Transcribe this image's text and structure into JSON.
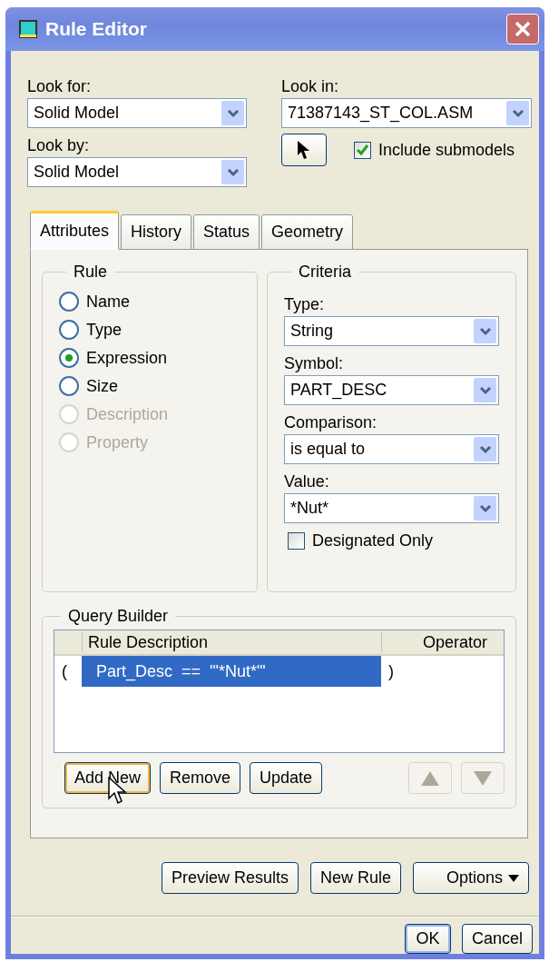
{
  "window": {
    "title": "Rule Editor"
  },
  "look_for": {
    "label": "Look for:",
    "value": "Solid Model"
  },
  "look_by": {
    "label": "Look by:",
    "value": "Solid Model"
  },
  "look_in": {
    "label": "Look in:",
    "value": "71387143_ST_COL.ASM"
  },
  "include_submodels": {
    "label": "Include submodels",
    "checked": true
  },
  "tabs": [
    {
      "label": "Attributes",
      "selected": true
    },
    {
      "label": "History",
      "selected": false
    },
    {
      "label": "Status",
      "selected": false
    },
    {
      "label": "Geometry",
      "selected": false
    }
  ],
  "rule_group": {
    "title": "Rule",
    "options": [
      {
        "label": "Name",
        "selected": false,
        "disabled": false
      },
      {
        "label": "Type",
        "selected": false,
        "disabled": false
      },
      {
        "label": "Expression",
        "selected": true,
        "disabled": false
      },
      {
        "label": "Size",
        "selected": false,
        "disabled": false
      },
      {
        "label": "Description",
        "selected": false,
        "disabled": true
      },
      {
        "label": "Property",
        "selected": false,
        "disabled": true
      }
    ]
  },
  "criteria": {
    "title": "Criteria",
    "fields": [
      {
        "label": "Type:",
        "value": "String"
      },
      {
        "label": "Symbol:",
        "value": "PART_DESC"
      },
      {
        "label": "Comparison:",
        "value": "is equal to"
      },
      {
        "label": "Value:",
        "value": "*Nut*"
      }
    ],
    "designated_only": {
      "label": "Designated Only",
      "checked": false
    }
  },
  "query_builder": {
    "title": "Query Builder",
    "columns": [
      "Rule Description",
      "Operator"
    ],
    "rows": [
      {
        "open": "(",
        "description": "Part_Desc  ==  '\"*Nut*\"'",
        "close": ")",
        "selected": true
      }
    ],
    "buttons": [
      {
        "label": "Add New",
        "focused": true
      },
      {
        "label": "Remove",
        "focused": false
      },
      {
        "label": "Update",
        "focused": false
      }
    ],
    "move_buttons": [
      {
        "kind": "up",
        "disabled": true
      },
      {
        "kind": "down",
        "disabled": true
      }
    ]
  },
  "actions": [
    {
      "label": "Preview Results",
      "kind": "plain"
    },
    {
      "label": "New Rule",
      "kind": "plain"
    },
    {
      "label": "Options",
      "kind": "menu"
    }
  ],
  "dialog_buttons": [
    {
      "label": "OK",
      "default": true
    },
    {
      "label": "Cancel",
      "default": false
    }
  ]
}
